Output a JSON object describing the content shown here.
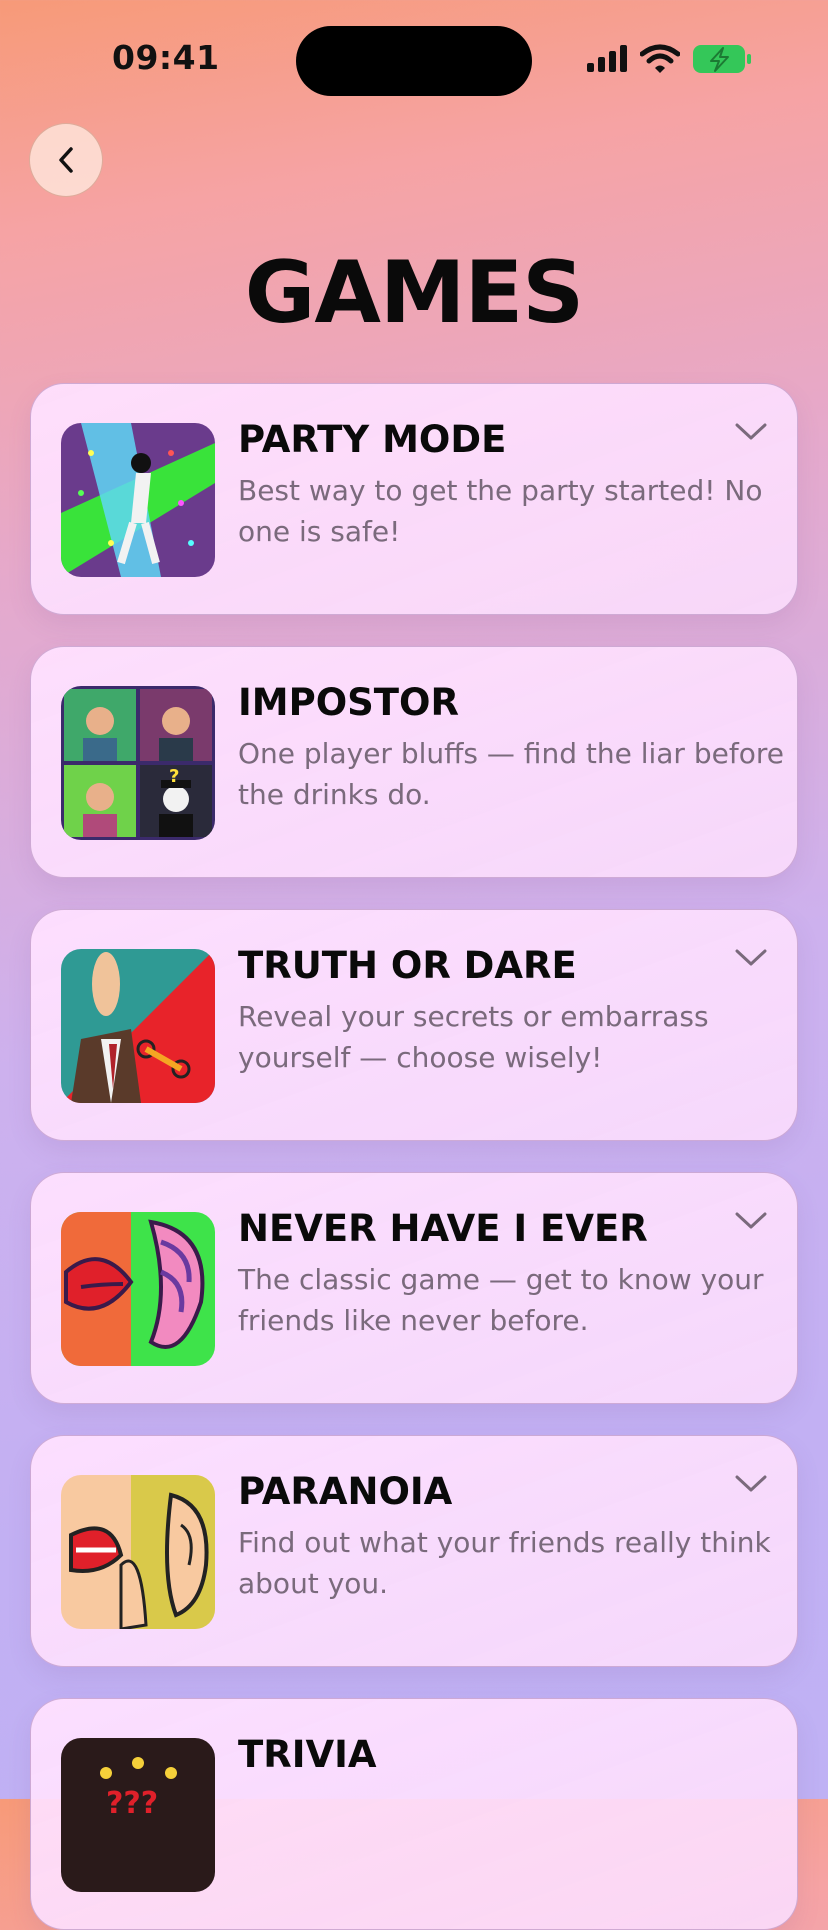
{
  "status_bar": {
    "time": "09:41"
  },
  "header": {
    "title": "GAMES"
  },
  "games": [
    {
      "title": "PARTY MODE",
      "description": "Best way to get the party started! No one is safe!",
      "expandable": true
    },
    {
      "title": "IMPOSTOR",
      "description": "One player bluffs — find the liar before the drinks do.",
      "expandable": false
    },
    {
      "title": "TRUTH OR DARE",
      "description": "Reveal your secrets or embarrass yourself — choose wisely!",
      "expandable": true
    },
    {
      "title": "NEVER HAVE I EVER",
      "description": "The classic game — get to know your friends like never before.",
      "expandable": true
    },
    {
      "title": "PARANOIA",
      "description": "Find out what your friends really think about you.",
      "expandable": true
    },
    {
      "title": "TRIVIA",
      "description": "",
      "expandable": false
    }
  ],
  "colors": {
    "accent_green": "#34c759",
    "title_black": "#0a0a0a",
    "description_gray": "#7a6a7c"
  }
}
